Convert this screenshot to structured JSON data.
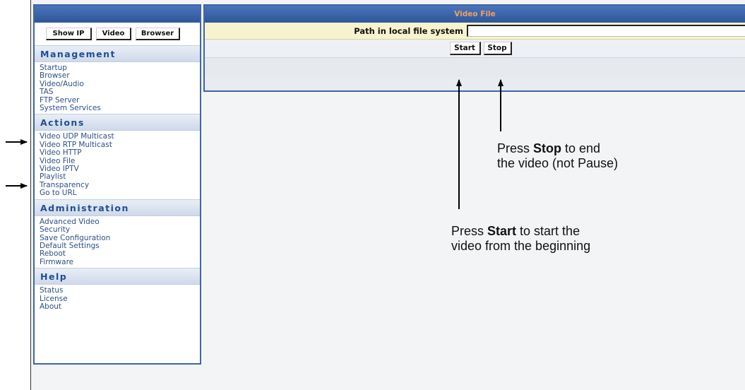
{
  "sidebar": {
    "buttons": {
      "show_ip": "Show IP",
      "video": "Video",
      "browser": "Browser"
    },
    "sections": [
      {
        "title": "Management",
        "items": [
          "Startup",
          "Browser",
          "Video/Audio",
          "TAS",
          "FTP Server",
          "System Services"
        ]
      },
      {
        "title": "Actions",
        "items": [
          "Video UDP Multicast",
          "Video RTP Multicast",
          "Video HTTP",
          "Video File",
          "Video IPTV",
          "Playlist",
          "Transparency",
          "Go to URL"
        ]
      },
      {
        "title": "Administration",
        "items": [
          "Advanced Video",
          "Security",
          "Save Configuration",
          "Default Settings",
          "Reboot",
          "Firmware"
        ]
      },
      {
        "title": "Help",
        "items": [
          "Status",
          "License",
          "About"
        ]
      }
    ]
  },
  "main": {
    "title": "Video File",
    "path_label": "Path in local file system",
    "path_value": "",
    "start_label": "Start",
    "stop_label": "Stop"
  },
  "annotations": {
    "stop": {
      "prefix": "Press ",
      "bold": "Stop",
      "line1_rest": " to end",
      "line2": "the video (not Pause)"
    },
    "start": {
      "prefix": "Press ",
      "bold": "Start",
      "line1_rest": " to start the",
      "line2": "video from the beginning"
    }
  },
  "colors": {
    "header_blue": "#3f66a8",
    "section_text": "#1f4e91",
    "title_orange": "#f0a060",
    "path_row_bg": "#f7f3cf"
  }
}
